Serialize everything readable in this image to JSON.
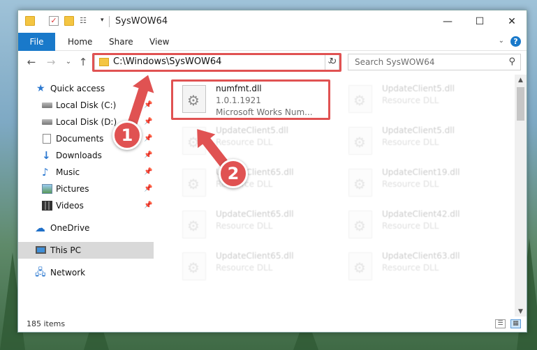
{
  "window": {
    "title": "SysWOW64"
  },
  "controls": {
    "minimize": "—",
    "maximize": "☐",
    "close": "✕"
  },
  "ribbon": {
    "tabs": [
      "File",
      "Home",
      "Share",
      "View"
    ],
    "help": "?"
  },
  "address": {
    "path": "C:\\Windows\\SysWOW64"
  },
  "search": {
    "placeholder": "Search SysWOW64"
  },
  "sidebar": {
    "items": [
      {
        "label": "Quick access",
        "icon": "star-icon",
        "pinned": false
      },
      {
        "label": "Local Disk (C:)",
        "icon": "drive-icon",
        "pinned": true
      },
      {
        "label": "Local Disk (D:)",
        "icon": "drive-icon",
        "pinned": true
      },
      {
        "label": "Documents",
        "icon": "documents-icon",
        "pinned": true
      },
      {
        "label": "Downloads",
        "icon": "download-icon",
        "pinned": true
      },
      {
        "label": "Music",
        "icon": "music-icon",
        "pinned": true
      },
      {
        "label": "Pictures",
        "icon": "pictures-icon",
        "pinned": true
      },
      {
        "label": "Videos",
        "icon": "videos-icon",
        "pinned": true
      },
      {
        "label": "OneDrive",
        "icon": "cloud-icon",
        "pinned": false
      },
      {
        "label": "This PC",
        "icon": "computer-icon",
        "pinned": false,
        "selected": true
      },
      {
        "label": "Network",
        "icon": "network-icon",
        "pinned": false
      }
    ]
  },
  "files": [
    {
      "name": "numfmt.dll",
      "version": "1.0.1.1921",
      "description": "Microsoft Works Num...",
      "highlighted": true
    },
    {
      "name": "UpdateClient5.dll",
      "description": "Resource DLL"
    },
    {
      "name": "UpdateClient5.dll",
      "description": "Resource DLL"
    },
    {
      "name": "UpdateClient5.dll",
      "description": "Resource DLL"
    },
    {
      "name": "UpdateClient65.dll",
      "description": "Resource DLL"
    },
    {
      "name": "UpdateClient19.dll",
      "description": "Resource DLL"
    },
    {
      "name": "UpdateClient65.dll",
      "description": "Resource DLL"
    },
    {
      "name": "UpdateClient42.dll",
      "description": "Resource DLL"
    },
    {
      "name": "UpdateClient65.dll",
      "description": "Resource DLL"
    },
    {
      "name": "UpdateClient63.dll",
      "description": "Resource DLL"
    }
  ],
  "status": {
    "count": "185 items"
  },
  "callouts": [
    "1",
    "2"
  ],
  "colors": {
    "accent": "#1979ca",
    "highlight": "#e05252",
    "selection": "#d9d9d9"
  }
}
